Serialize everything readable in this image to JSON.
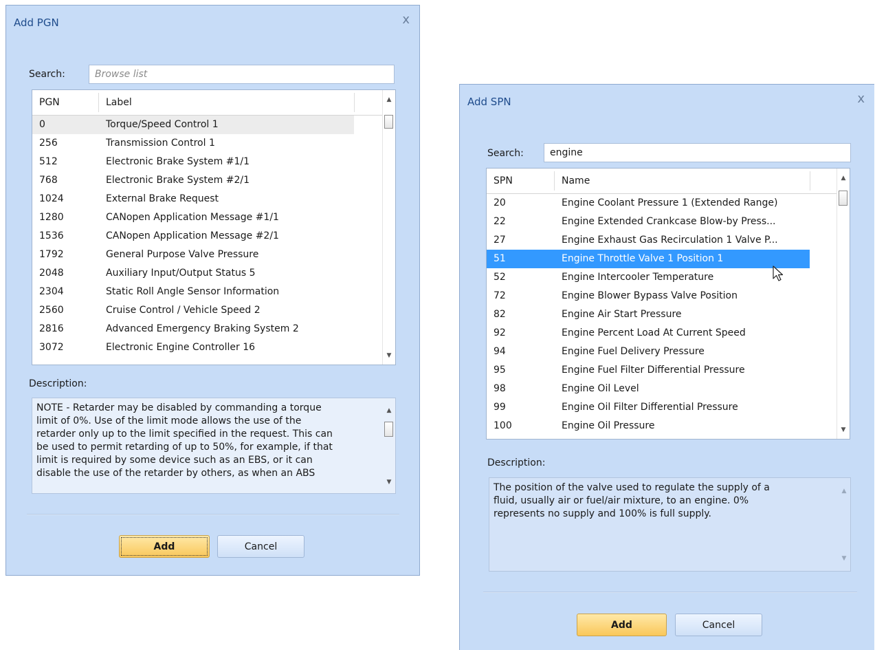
{
  "pgn_dialog": {
    "title": "Add PGN",
    "close": "x",
    "search_label": "Search:",
    "search_value": "",
    "search_placeholder": "Browse list",
    "columns": [
      "PGN",
      "Label"
    ],
    "rows": [
      [
        "0",
        "Torque/Speed Control 1"
      ],
      [
        "256",
        "Transmission Control 1"
      ],
      [
        "512",
        "Electronic Brake System #1/1"
      ],
      [
        "768",
        "Electronic Brake System #2/1"
      ],
      [
        "1024",
        "External Brake Request"
      ],
      [
        "1280",
        "CANopen Application Message #1/1"
      ],
      [
        "1536",
        "CANopen Application Message #2/1"
      ],
      [
        "1792",
        "General Purpose Valve Pressure"
      ],
      [
        "2048",
        "Auxiliary Input/Output Status 5"
      ],
      [
        "2304",
        "Static Roll Angle Sensor Information"
      ],
      [
        "2560",
        "Cruise Control / Vehicle Speed 2"
      ],
      [
        "2816",
        "Advanced Emergency Braking System 2"
      ],
      [
        "3072",
        "Electronic Engine Controller 16"
      ]
    ],
    "description_label": "Description:",
    "description": "NOTE - Retarder may be disabled by commanding a torque\nlimit of 0%.  Use of the limit mode allows the use of the\nretarder only up to the limit specified in the request.  This can\nbe used to permit retarding of up to 50%, for example, if that\nlimit is required by some device such as an EBS, or it can\ndisable the use of the retarder by others, as when an ABS",
    "add_label": "Add",
    "cancel_label": "Cancel"
  },
  "spn_dialog": {
    "title": "Add SPN",
    "close": "x",
    "search_label": "Search:",
    "search_value": "engine",
    "columns": [
      "SPN",
      "Name"
    ],
    "rows": [
      [
        "20",
        "Engine Coolant Pressure 1 (Extended Range)"
      ],
      [
        "22",
        "Engine Extended Crankcase Blow-by Press..."
      ],
      [
        "27",
        "Engine Exhaust Gas Recirculation 1 Valve P..."
      ],
      [
        "51",
        "Engine Throttle Valve 1 Position 1"
      ],
      [
        "52",
        "Engine Intercooler Temperature"
      ],
      [
        "72",
        "Engine Blower Bypass Valve Position"
      ],
      [
        "82",
        "Engine Air Start Pressure"
      ],
      [
        "92",
        "Engine Percent Load At Current Speed"
      ],
      [
        "94",
        "Engine Fuel Delivery Pressure"
      ],
      [
        "95",
        "Engine Fuel Filter Differential Pressure"
      ],
      [
        "98",
        "Engine Oil Level"
      ],
      [
        "99",
        "Engine Oil Filter Differential Pressure"
      ],
      [
        "100",
        "Engine Oil Pressure"
      ]
    ],
    "selected_spn": "51",
    "description_label": "Description:",
    "description": "The position of the valve used to regulate the supply of a\nfluid, usually air or fuel/air mixture, to an engine.  0%\nrepresents no supply and 100% is full supply.",
    "add_label": "Add",
    "cancel_label": "Cancel"
  },
  "icons": {
    "scroll_up": "up-arrow",
    "scroll_down": "down-arrow",
    "mouse_cursor": "arrow-pointer"
  }
}
